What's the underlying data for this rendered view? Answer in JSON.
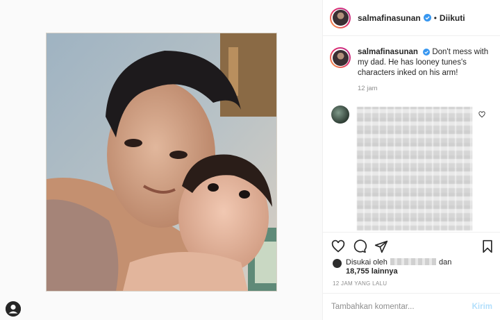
{
  "post": {
    "username": "salmafinasunan",
    "follow_status": "Diikuti",
    "caption": "Don't mess with my dad. He has looney tunes's characters inked on his arm!",
    "caption_time": "12 jam"
  },
  "likes": {
    "prefix": "Disukai oleh",
    "and_text": "dan",
    "count_text": "18,755 lainnya"
  },
  "date_line": "12 JAM YANG LALU",
  "comment_box": {
    "placeholder": "Tambahkan komentar...",
    "post_label": "Kirim"
  },
  "colors": {
    "verified": "#3897f0",
    "post_button": "#b2dffc",
    "muted_text": "#8e8e8e"
  },
  "icons": [
    "verified-icon",
    "heart-icon",
    "comment-icon",
    "share-icon",
    "bookmark-icon",
    "small-heart-icon"
  ]
}
